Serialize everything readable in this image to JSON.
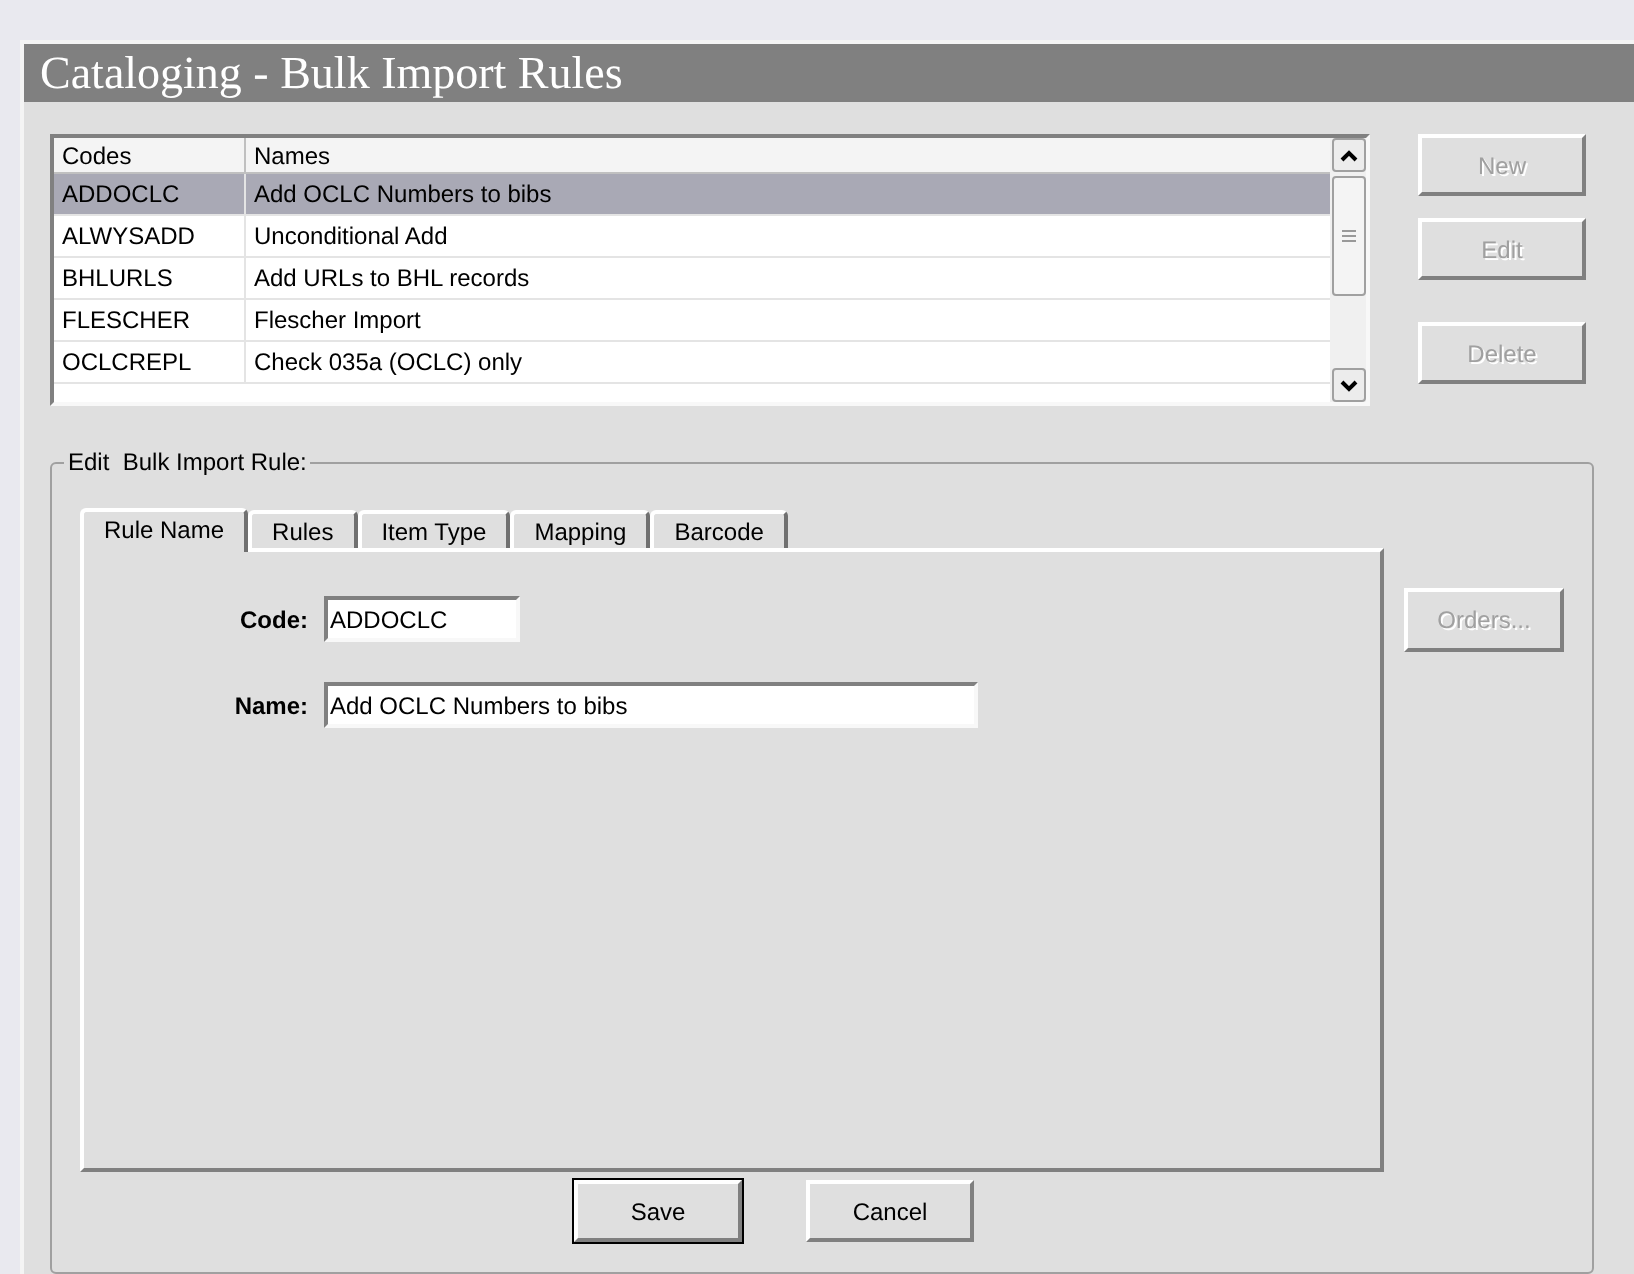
{
  "window": {
    "title": "Cataloging - Bulk Import Rules"
  },
  "list": {
    "columns": [
      "Codes",
      "Names"
    ],
    "rows": [
      {
        "code": "ADDOCLC",
        "name": "Add OCLC Numbers to bibs",
        "selected": true
      },
      {
        "code": "ALWYSADD",
        "name": "Unconditional Add",
        "selected": false
      },
      {
        "code": "BHLURLS",
        "name": "Add URLs to BHL records",
        "selected": false
      },
      {
        "code": "FLESCHER",
        "name": "Flescher Import",
        "selected": false
      },
      {
        "code": "OCLCREPL",
        "name": "Check 035a (OCLC) only",
        "selected": false
      }
    ]
  },
  "side_buttons": [
    {
      "label": "New",
      "disabled": true
    },
    {
      "label": "Edit",
      "disabled": true
    },
    {
      "label": "Delete",
      "disabled": true
    }
  ],
  "group": {
    "title": "Edit  Bulk Import Rule:"
  },
  "tabs": [
    {
      "label": "Rule Name",
      "selected": true
    },
    {
      "label": "Rules",
      "selected": false
    },
    {
      "label": "Item Type",
      "selected": false
    },
    {
      "label": "Mapping",
      "selected": false
    },
    {
      "label": "Barcode",
      "selected": false
    }
  ],
  "fields": [
    {
      "label": "Code:",
      "value": "ADDOCLC"
    },
    {
      "label": "Name:",
      "value": "Add OCLC Numbers to bibs"
    }
  ],
  "orders_button": {
    "label": "Orders...",
    "disabled": true
  },
  "bottom_buttons": [
    {
      "label": "Save",
      "default": true
    },
    {
      "label": "Cancel",
      "default": false
    }
  ]
}
